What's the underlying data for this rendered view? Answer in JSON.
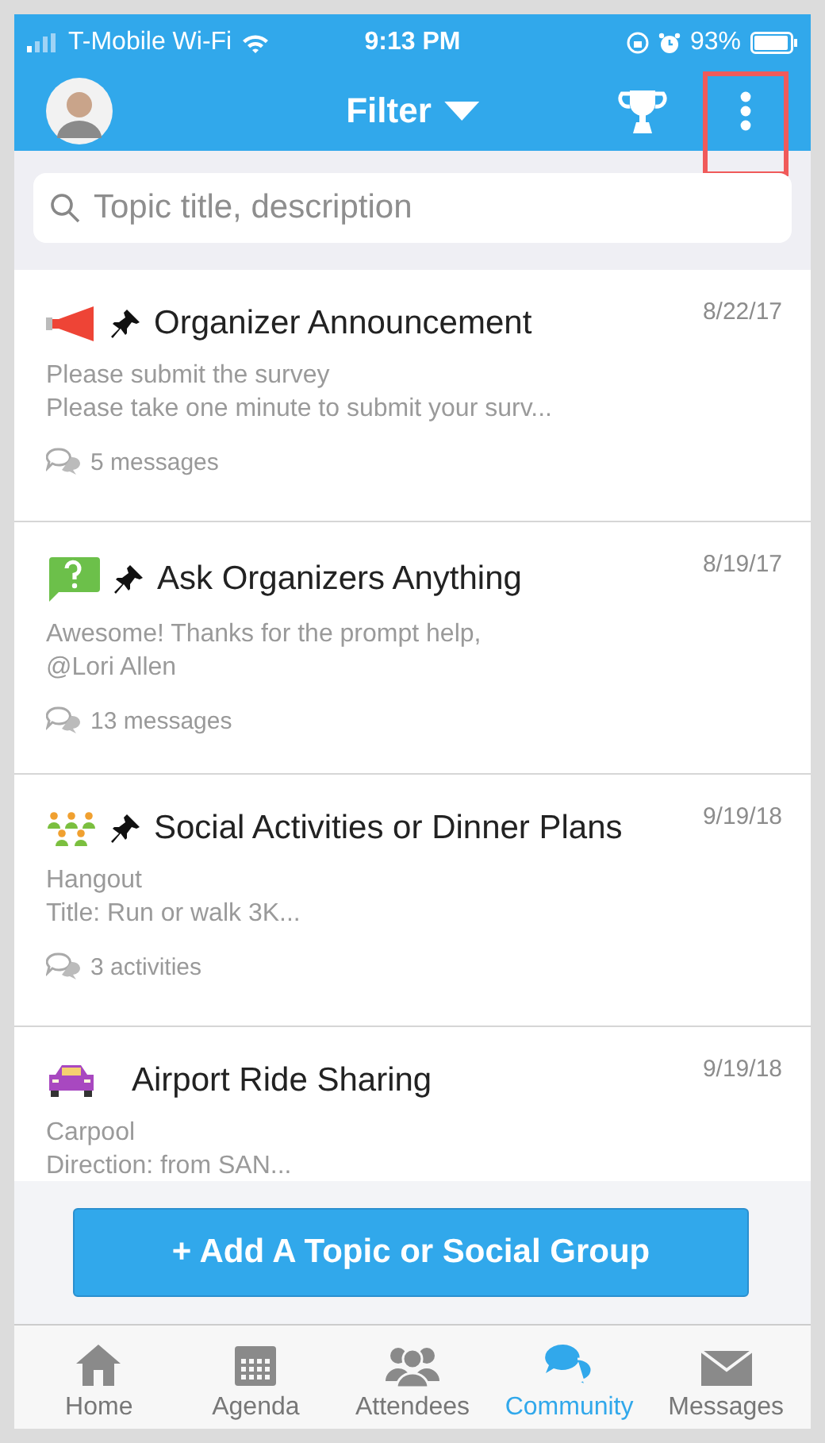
{
  "status_bar": {
    "carrier": "T-Mobile Wi-Fi",
    "time": "9:13 PM",
    "battery": "93%"
  },
  "header": {
    "title": "Filter",
    "menu_highlighted": true
  },
  "search": {
    "placeholder": "Topic title, description"
  },
  "topics": [
    {
      "kind": "megaphone",
      "pinned": true,
      "title": "Organizer Announcement",
      "date": "8/22/17",
      "lines": [
        "Please submit the survey",
        "Please take one minute to submit your surv..."
      ],
      "footer": "5 messages"
    },
    {
      "kind": "question",
      "pinned": true,
      "title": "Ask Organizers Anything",
      "date": "8/19/17",
      "lines": [
        "Awesome! Thanks for the prompt help,",
        "@Lori Allen"
      ],
      "footer": "13 messages"
    },
    {
      "kind": "people",
      "pinned": true,
      "title": "Social Activities or Dinner Plans",
      "date": "9/19/18",
      "lines": [
        "Hangout",
        "Title: Run or walk 3K..."
      ],
      "footer": "3 activities"
    },
    {
      "kind": "car",
      "pinned": false,
      "title": "Airport Ride Sharing",
      "date": "9/19/18",
      "lines": [
        "Carpool",
        "Direction: from SAN..."
      ]
    }
  ],
  "add_button": "+ Add A Topic or Social Group",
  "tabs": [
    {
      "kind": "home",
      "label": "Home",
      "selected": false
    },
    {
      "kind": "agenda",
      "label": "Agenda",
      "selected": false
    },
    {
      "kind": "attendees",
      "label": "Attendees",
      "selected": false
    },
    {
      "kind": "community",
      "label": "Community",
      "selected": true
    },
    {
      "kind": "messages",
      "label": "Messages",
      "selected": false
    }
  ]
}
